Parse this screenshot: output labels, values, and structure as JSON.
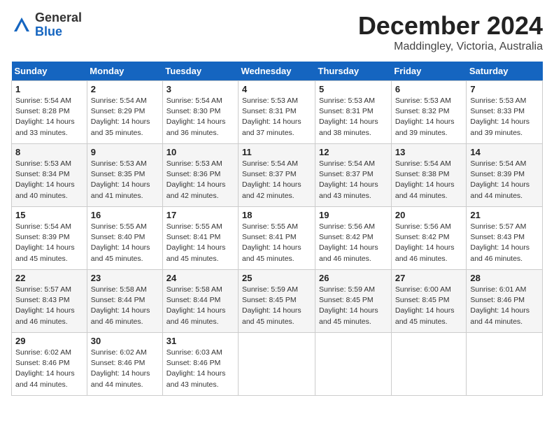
{
  "header": {
    "logo_general": "General",
    "logo_blue": "Blue",
    "month_title": "December 2024",
    "location": "Maddingley, Victoria, Australia"
  },
  "weekdays": [
    "Sunday",
    "Monday",
    "Tuesday",
    "Wednesday",
    "Thursday",
    "Friday",
    "Saturday"
  ],
  "weeks": [
    [
      {
        "day": "1",
        "sunrise": "5:54 AM",
        "sunset": "8:28 PM",
        "daylight": "14 hours and 33 minutes."
      },
      {
        "day": "2",
        "sunrise": "5:54 AM",
        "sunset": "8:29 PM",
        "daylight": "14 hours and 35 minutes."
      },
      {
        "day": "3",
        "sunrise": "5:54 AM",
        "sunset": "8:30 PM",
        "daylight": "14 hours and 36 minutes."
      },
      {
        "day": "4",
        "sunrise": "5:53 AM",
        "sunset": "8:31 PM",
        "daylight": "14 hours and 37 minutes."
      },
      {
        "day": "5",
        "sunrise": "5:53 AM",
        "sunset": "8:31 PM",
        "daylight": "14 hours and 38 minutes."
      },
      {
        "day": "6",
        "sunrise": "5:53 AM",
        "sunset": "8:32 PM",
        "daylight": "14 hours and 39 minutes."
      },
      {
        "day": "7",
        "sunrise": "5:53 AM",
        "sunset": "8:33 PM",
        "daylight": "14 hours and 39 minutes."
      }
    ],
    [
      {
        "day": "8",
        "sunrise": "5:53 AM",
        "sunset": "8:34 PM",
        "daylight": "14 hours and 40 minutes."
      },
      {
        "day": "9",
        "sunrise": "5:53 AM",
        "sunset": "8:35 PM",
        "daylight": "14 hours and 41 minutes."
      },
      {
        "day": "10",
        "sunrise": "5:53 AM",
        "sunset": "8:36 PM",
        "daylight": "14 hours and 42 minutes."
      },
      {
        "day": "11",
        "sunrise": "5:54 AM",
        "sunset": "8:37 PM",
        "daylight": "14 hours and 42 minutes."
      },
      {
        "day": "12",
        "sunrise": "5:54 AM",
        "sunset": "8:37 PM",
        "daylight": "14 hours and 43 minutes."
      },
      {
        "day": "13",
        "sunrise": "5:54 AM",
        "sunset": "8:38 PM",
        "daylight": "14 hours and 44 minutes."
      },
      {
        "day": "14",
        "sunrise": "5:54 AM",
        "sunset": "8:39 PM",
        "daylight": "14 hours and 44 minutes."
      }
    ],
    [
      {
        "day": "15",
        "sunrise": "5:54 AM",
        "sunset": "8:39 PM",
        "daylight": "14 hours and 45 minutes."
      },
      {
        "day": "16",
        "sunrise": "5:55 AM",
        "sunset": "8:40 PM",
        "daylight": "14 hours and 45 minutes."
      },
      {
        "day": "17",
        "sunrise": "5:55 AM",
        "sunset": "8:41 PM",
        "daylight": "14 hours and 45 minutes."
      },
      {
        "day": "18",
        "sunrise": "5:55 AM",
        "sunset": "8:41 PM",
        "daylight": "14 hours and 45 minutes."
      },
      {
        "day": "19",
        "sunrise": "5:56 AM",
        "sunset": "8:42 PM",
        "daylight": "14 hours and 46 minutes."
      },
      {
        "day": "20",
        "sunrise": "5:56 AM",
        "sunset": "8:42 PM",
        "daylight": "14 hours and 46 minutes."
      },
      {
        "day": "21",
        "sunrise": "5:57 AM",
        "sunset": "8:43 PM",
        "daylight": "14 hours and 46 minutes."
      }
    ],
    [
      {
        "day": "22",
        "sunrise": "5:57 AM",
        "sunset": "8:43 PM",
        "daylight": "14 hours and 46 minutes."
      },
      {
        "day": "23",
        "sunrise": "5:58 AM",
        "sunset": "8:44 PM",
        "daylight": "14 hours and 46 minutes."
      },
      {
        "day": "24",
        "sunrise": "5:58 AM",
        "sunset": "8:44 PM",
        "daylight": "14 hours and 46 minutes."
      },
      {
        "day": "25",
        "sunrise": "5:59 AM",
        "sunset": "8:45 PM",
        "daylight": "14 hours and 45 minutes."
      },
      {
        "day": "26",
        "sunrise": "5:59 AM",
        "sunset": "8:45 PM",
        "daylight": "14 hours and 45 minutes."
      },
      {
        "day": "27",
        "sunrise": "6:00 AM",
        "sunset": "8:45 PM",
        "daylight": "14 hours and 45 minutes."
      },
      {
        "day": "28",
        "sunrise": "6:01 AM",
        "sunset": "8:46 PM",
        "daylight": "14 hours and 44 minutes."
      }
    ],
    [
      {
        "day": "29",
        "sunrise": "6:02 AM",
        "sunset": "8:46 PM",
        "daylight": "14 hours and 44 minutes."
      },
      {
        "day": "30",
        "sunrise": "6:02 AM",
        "sunset": "8:46 PM",
        "daylight": "14 hours and 44 minutes."
      },
      {
        "day": "31",
        "sunrise": "6:03 AM",
        "sunset": "8:46 PM",
        "daylight": "14 hours and 43 minutes."
      },
      null,
      null,
      null,
      null
    ]
  ]
}
